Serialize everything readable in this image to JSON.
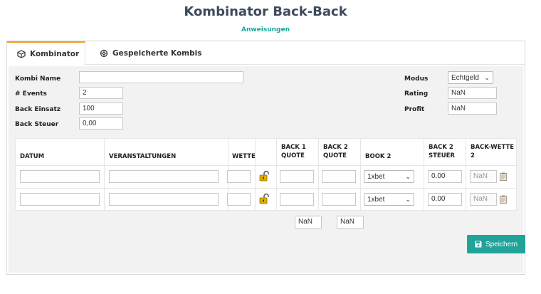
{
  "page": {
    "title": "Kombinator Back-Back",
    "instructions_link": "Anweisungen"
  },
  "tabs": [
    {
      "label": "Kombinator",
      "icon": "cube-icon"
    },
    {
      "label": "Gespeicherte Kombis",
      "icon": "settings-icon"
    }
  ],
  "form": {
    "kombi_name_label": "Kombi Name",
    "kombi_name_value": "",
    "events_label": "# Events",
    "events_value": "2",
    "back_einsatz_label": "Back Einsatz",
    "back_einsatz_value": "100",
    "back_steuer_label": "Back Steuer",
    "back_steuer_value": "0,00",
    "modus_label": "Modus",
    "modus_value": "Echtgeld",
    "rating_label": "Rating",
    "rating_value": "NaN",
    "profit_label": "Profit",
    "profit_value": "NaN"
  },
  "table": {
    "headers": {
      "datum": "DATUM",
      "veranstaltungen": "VERANSTALTUNGEN",
      "wette": "WETTE",
      "back1_line1": "BACK 1",
      "back1_line2": "QUOTE",
      "back2_line1": "BACK 2",
      "back2_line2": "QUOTE",
      "book2": "BOOK 2",
      "steuer_line1": "BACK 2",
      "steuer_line2": "STEUER",
      "backwette_line1": "BACK-WETTE",
      "backwette_line2": "2"
    },
    "rows": [
      {
        "datum": "",
        "veranstaltung": "",
        "wette": "",
        "back1": "",
        "back2": "",
        "book2": "1xbet",
        "steuer": "0.00",
        "backwette": "NaN"
      },
      {
        "datum": "",
        "veranstaltung": "",
        "wette": "",
        "back1": "",
        "back2": "",
        "book2": "1xbet",
        "steuer": "0.00",
        "backwette": "NaN"
      }
    ],
    "totals": {
      "back1": "NaN",
      "back2": "NaN"
    }
  },
  "actions": {
    "save_label": "Speichern"
  },
  "colors": {
    "accent": "#21a39a",
    "tab_active_border": "#f0a020",
    "lock": "#e0b000"
  }
}
